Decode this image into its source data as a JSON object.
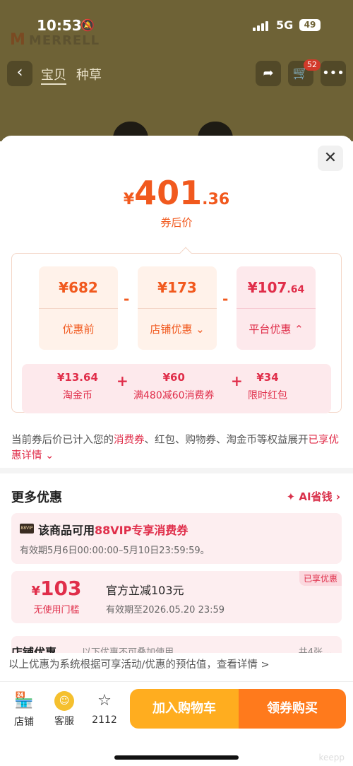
{
  "status_bar": {
    "time": "10:53",
    "network": "5G",
    "battery": "49"
  },
  "background_page": {
    "brand": "MERRELL",
    "tabs": [
      "宝贝",
      "种草"
    ],
    "cart_count": "52"
  },
  "price": {
    "currency": "¥",
    "integer": "401",
    "decimal": ".36",
    "label": "券后价"
  },
  "breakdown": {
    "original": {
      "value": "¥682",
      "label": "优惠前"
    },
    "shop": {
      "value": "¥173",
      "label": "店铺优惠"
    },
    "platform": {
      "value_int": "¥107",
      "value_dec": ".64",
      "label": "平台优惠"
    },
    "operator": "-",
    "sub_items": [
      {
        "value": "¥13.64",
        "label": "淘金币"
      },
      {
        "value": "¥60",
        "label": "满480减60消费券"
      },
      {
        "value": "¥34",
        "label": "限时红包"
      }
    ],
    "plus": "+"
  },
  "note": {
    "prefix": "当前券后价已计入您的",
    "highlight": "消费券",
    "middle": "、红包、购物券、淘金币等权益展开",
    "link": "已享优惠详情"
  },
  "more": {
    "title": "更多优惠",
    "ai_link": "AI省钱",
    "vip": {
      "badge": "88VIP",
      "title_prefix": "该商品可用",
      "title_highlight": "88VIP专享消费券",
      "valid": "有效期5月6日00:00:00–5月10日23:59:59。"
    },
    "coupon": {
      "currency": "¥",
      "amount": "103",
      "condition": "无使用门槛",
      "name": "官方立减103元",
      "valid": "有效期至2026.05.20 23:59",
      "tag": "已享优惠"
    },
    "shop": {
      "title": "店铺优惠",
      "subtitle": "以下优惠不可叠加使用",
      "count": "共4张"
    }
  },
  "disclaimer": "以上优惠为系统根据可享活动/优惠的预估值，查看详情 >",
  "bottom_bar": {
    "store": "店铺",
    "service": "客服",
    "favorites": "2112",
    "add_to_cart": "加入购物车",
    "buy": "领券购买",
    "watermark": "keepp"
  },
  "colors": {
    "orange": "#f1591e",
    "red": "#e02e4a",
    "cart_button": "#ffad1f",
    "buy_button": "#ff7a1c"
  }
}
